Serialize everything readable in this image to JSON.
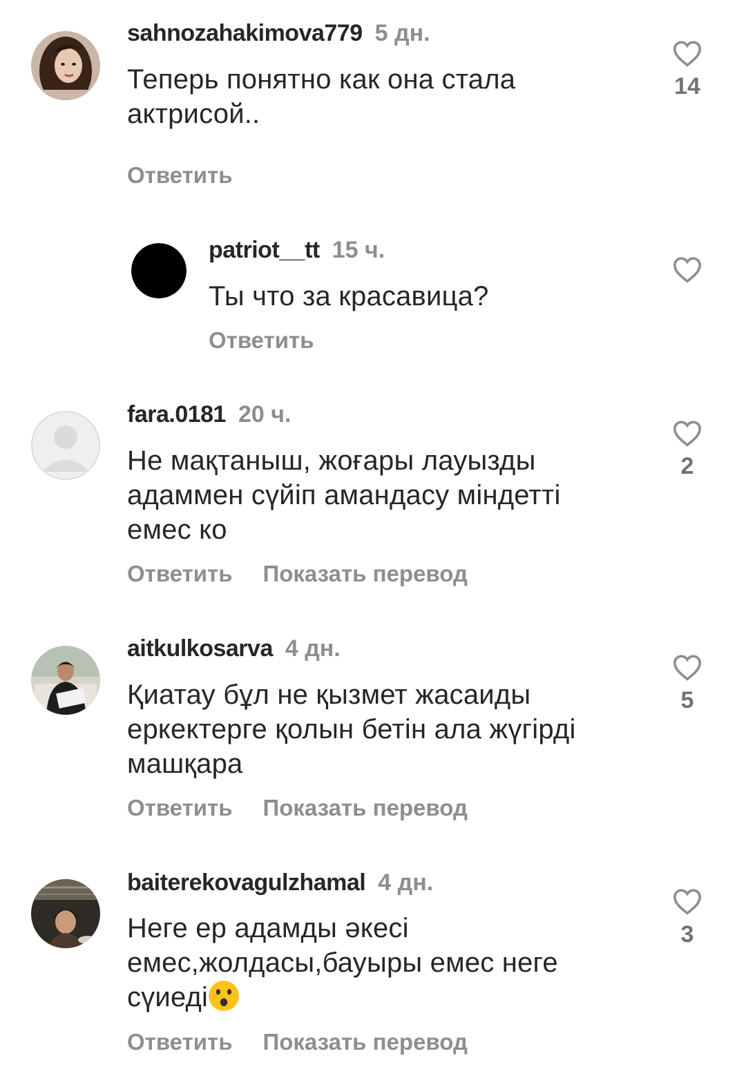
{
  "comments": [
    {
      "username": "sahnozahakimova779",
      "time": "5 дн.",
      "text": "Теперь понятно как она стала актрисой..",
      "reply_label": "Ответить",
      "likes": "14",
      "avatar_icon": "user-photo-avatar"
    },
    {
      "username": "patriot__tt",
      "time": "15 ч.",
      "text": "Ты что за красавица?",
      "reply_label": "Ответить",
      "avatar_icon": "black-circle-avatar"
    },
    {
      "username": "fara.0181",
      "time": "20 ч.",
      "text": "Не мақтаныш, жоғары лауызды адаммен сүйіп амандасу міндетті емес ко",
      "reply_label": "Ответить",
      "translate_label": "Показать перевод",
      "likes": "2",
      "avatar_icon": "default-user-avatar"
    },
    {
      "username": "aitkulkosarva",
      "time": "4 дн.",
      "text": "Қиатау бұл не қызмет жасаиды еркектерге қолын бетін ала жүгірді машқара",
      "reply_label": "Ответить",
      "translate_label": "Показать перевод",
      "likes": "5",
      "avatar_icon": "user-photo-avatar"
    },
    {
      "username": "baiterekovagulzhamal",
      "time": "4 дн.",
      "text": "Неге ер адамды әкесі емес,жолдасы,бауыры емес неге сүиеді",
      "text_emoji": "😯",
      "reply_label": "Ответить",
      "translate_label": "Показать перевод",
      "likes": "3",
      "avatar_icon": "user-photo-avatar"
    }
  ],
  "colors": {
    "text": "#262626",
    "secondary": "#8e8e8e",
    "heart_outline": "#8e8e8e",
    "background": "#ffffff"
  }
}
